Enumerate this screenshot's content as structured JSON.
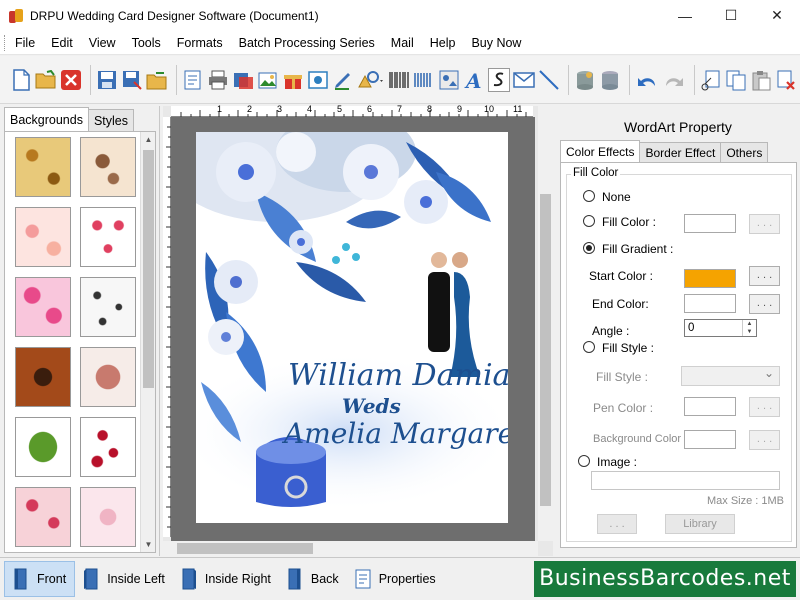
{
  "window": {
    "title": "DRPU Wedding Card Designer Software (Document1)"
  },
  "menu": [
    "File",
    "Edit",
    "View",
    "Tools",
    "Formats",
    "Batch Processing Series",
    "Mail",
    "Help",
    "Buy Now"
  ],
  "left_panel": {
    "tabs": [
      "Backgrounds",
      "Styles"
    ],
    "active_tab": "Backgrounds"
  },
  "ruler": {
    "labels": [
      "1",
      "2",
      "3",
      "4",
      "5",
      "6",
      "7",
      "8",
      "9",
      "10",
      "11"
    ]
  },
  "card": {
    "line1": "William Damian",
    "line2": "Weds",
    "line3": "Amelia Margaret"
  },
  "right_panel": {
    "title": "WordArt Property",
    "tabs": [
      "Color Effects",
      "Border Effect",
      "Others"
    ],
    "active_tab": "Color Effects",
    "group_label": "Fill Color",
    "none_label": "None",
    "fill_color_label": "Fill Color :",
    "fill_gradient_label": "Fill Gradient :",
    "start_color_label": "Start Color :",
    "end_color_label": "End Color:",
    "angle_label": "Angle :",
    "angle_value": "0",
    "fill_style_radio_label": "Fill Style :",
    "fill_style_label": "Fill Style :",
    "pen_color_label": "Pen Color :",
    "background_color_label": "Background Color :",
    "image_label": "Image :",
    "max_size_label": "Max Size : 1MB",
    "dots_label": ". . .",
    "library_label": "Library",
    "selected_option": "Fill Gradient",
    "start_color": "#f5a300",
    "end_color": "#ffffff"
  },
  "bottom_bar": {
    "items": [
      "Front",
      "Inside Left",
      "Inside Right",
      "Back",
      "Properties"
    ],
    "active": "Front",
    "brand": "BusinessBarcodes.net"
  },
  "colors": {
    "brand_green": "#187a3c",
    "card_text": "#1d4f8f"
  }
}
